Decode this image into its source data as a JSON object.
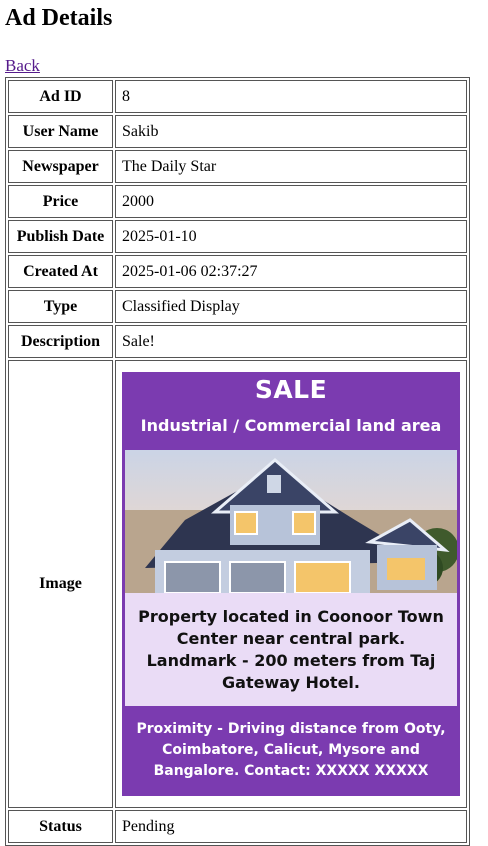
{
  "page": {
    "title": "Ad Details",
    "back_label": "Back"
  },
  "details": [
    {
      "label": "Ad ID",
      "value": "8"
    },
    {
      "label": "User Name",
      "value": "Sakib"
    },
    {
      "label": "Newspaper",
      "value": "The Daily Star"
    },
    {
      "label": "Price",
      "value": "2000"
    },
    {
      "label": "Publish Date",
      "value": "2025-01-10"
    },
    {
      "label": "Created At",
      "value": "2025-01-06 02:37:27"
    },
    {
      "label": "Type",
      "value": "Classified Display"
    },
    {
      "label": "Description",
      "value": "Sale!"
    }
  ],
  "image_row": {
    "label": "Image",
    "ad": {
      "headline": "SALE",
      "subheadline": "Industrial / Commercial land area",
      "body": "Property located in Coonoor Town Center near central park. Landmark - 200 meters from Taj Gateway Hotel.",
      "footer": "Proximity - Driving distance from Ooty, Coimbatore, Calicut, Mysore and Bangalore. Contact: XXXXX XXXXX",
      "colors": {
        "background": "#7b3bb0",
        "panel": "#eadcf6"
      }
    }
  },
  "status_row": {
    "label": "Status",
    "value": "Pending"
  }
}
